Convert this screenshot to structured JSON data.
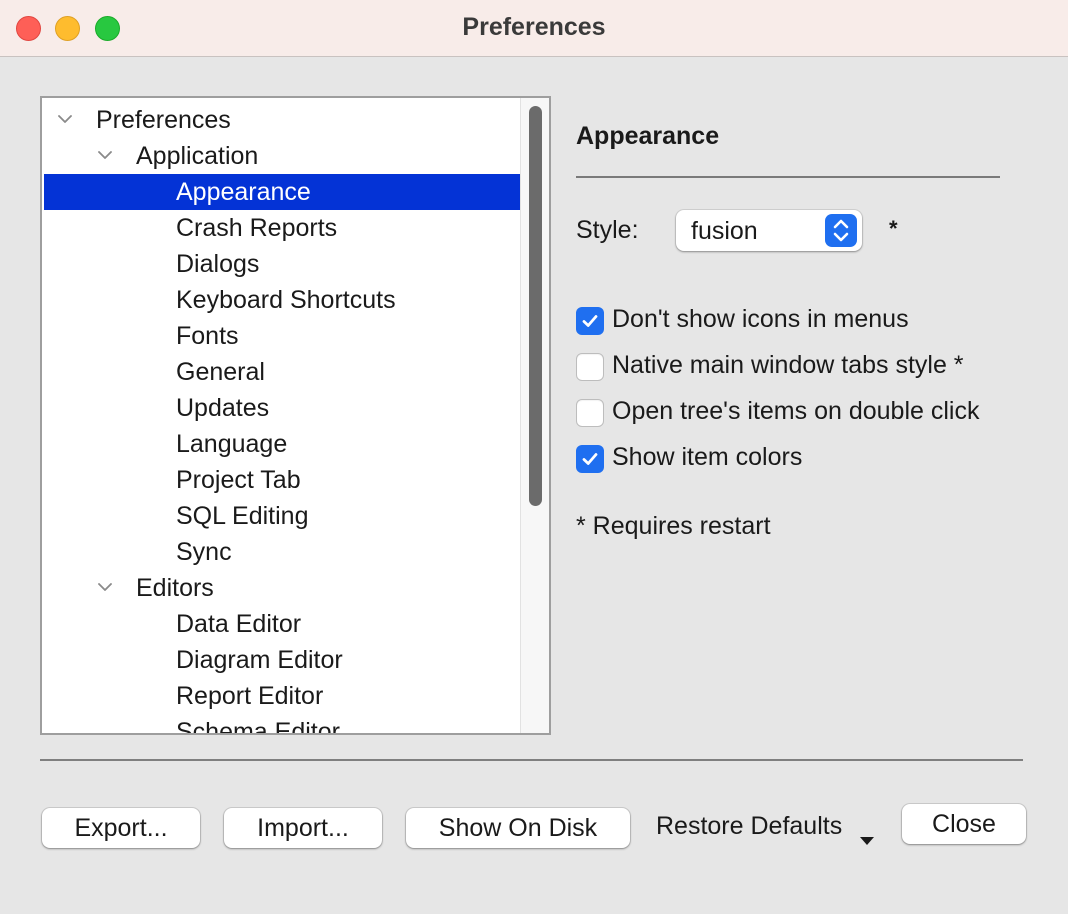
{
  "window": {
    "title": "Preferences"
  },
  "tree": {
    "items": [
      {
        "label": "Preferences",
        "level": 0,
        "expanded": true,
        "selected": false
      },
      {
        "label": "Application",
        "level": 1,
        "expanded": true,
        "selected": false
      },
      {
        "label": "Appearance",
        "level": 2,
        "selected": true
      },
      {
        "label": "Crash Reports",
        "level": 2,
        "selected": false
      },
      {
        "label": "Dialogs",
        "level": 2,
        "selected": false
      },
      {
        "label": "Keyboard Shortcuts",
        "level": 2,
        "selected": false
      },
      {
        "label": "Fonts",
        "level": 2,
        "selected": false
      },
      {
        "label": "General",
        "level": 2,
        "selected": false
      },
      {
        "label": "Updates",
        "level": 2,
        "selected": false
      },
      {
        "label": "Language",
        "level": 2,
        "selected": false
      },
      {
        "label": "Project Tab",
        "level": 2,
        "selected": false
      },
      {
        "label": "SQL Editing",
        "level": 2,
        "selected": false
      },
      {
        "label": "Sync",
        "level": 2,
        "selected": false
      },
      {
        "label": "Editors",
        "level": 1,
        "expanded": true,
        "selected": false
      },
      {
        "label": "Data Editor",
        "level": 2,
        "selected": false
      },
      {
        "label": "Diagram Editor",
        "level": 2,
        "selected": false
      },
      {
        "label": "Report Editor",
        "level": 2,
        "selected": false
      },
      {
        "label": "Schema Editor",
        "level": 2,
        "selected": false
      }
    ]
  },
  "panel": {
    "title": "Appearance",
    "style_label": "Style:",
    "style_value": "fusion",
    "style_note": "*",
    "checkboxes": [
      {
        "label": "Don't show icons in menus",
        "checked": true
      },
      {
        "label": "Native main window tabs style *",
        "checked": false
      },
      {
        "label": "Open tree's items on double click",
        "checked": false
      },
      {
        "label": "Show item colors",
        "checked": true
      }
    ],
    "restart_note": "* Requires restart"
  },
  "buttons": {
    "export": "Export...",
    "import": "Import...",
    "show_on_disk": "Show On Disk",
    "restore_defaults": "Restore Defaults",
    "close": "Close"
  },
  "colors": {
    "selection": "#0433d6",
    "accent": "#1f6ff0",
    "titlebar": "#f8ece9"
  }
}
